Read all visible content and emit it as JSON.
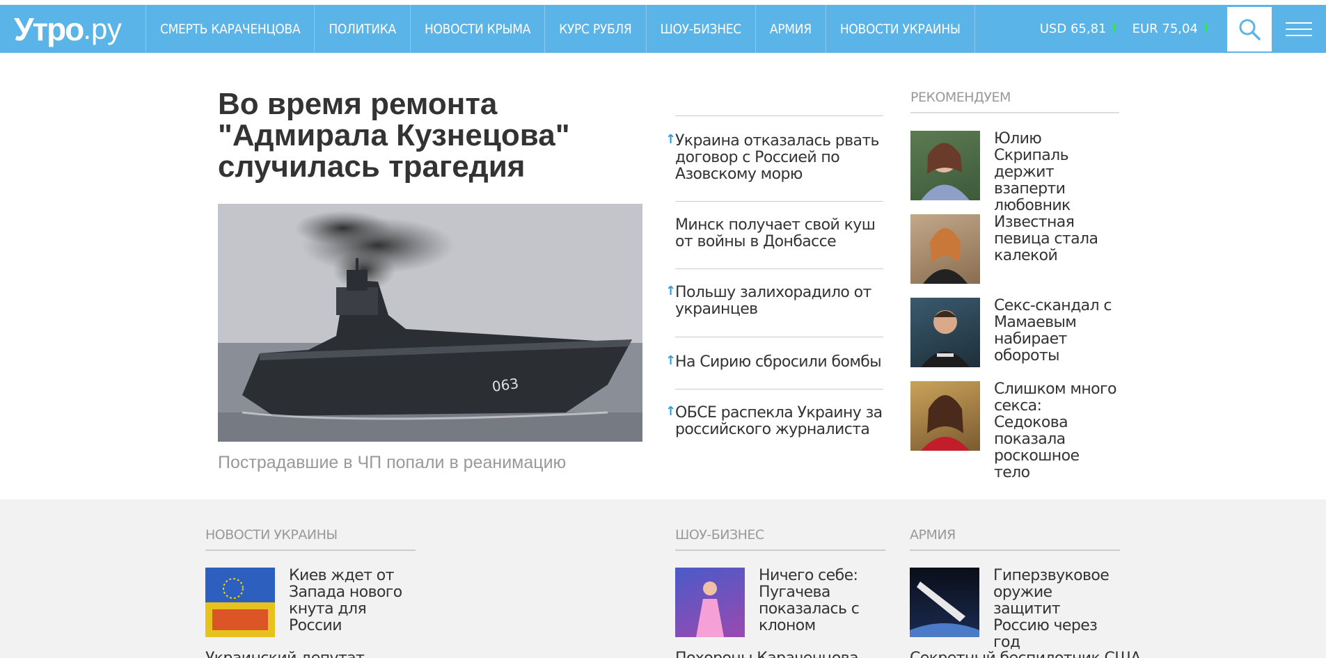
{
  "header": {
    "logo_main": "Утро",
    "logo_suffix": ".ру",
    "nav": [
      "Смерть Караченцова",
      "Политика",
      "Новости Крыма",
      "Курс рубля",
      "Шоу-бизнес",
      "Армия",
      "Новости Украины"
    ],
    "rates": [
      {
        "label": "USD",
        "value": "65,81",
        "arrow": "↑"
      },
      {
        "label": "EUR",
        "value": "75,04",
        "arrow": "↑"
      }
    ]
  },
  "main": {
    "title": "Во время ремонта \"Адмирала Кузнецова\" случилась трагедия",
    "caption": "Пострадавшие в ЧП попали в реанимацию"
  },
  "mid_list": [
    {
      "text": "Украина отказалась рвать договор с Россией по Азовскому морю",
      "up": true
    },
    {
      "text": "Минск получает свой куш от войны в Донбассе",
      "up": false
    },
    {
      "text": "Польшу залихорадило от украинцев",
      "up": true
    },
    {
      "text": "На Сирию сбросили бомбы",
      "up": true
    },
    {
      "text": "ОБСЕ распекла Украину за российского журналиста",
      "up": true
    }
  ],
  "recommended": {
    "heading": "Рекомендуем",
    "items": [
      "Юлию Скрипаль держит взаперти любовник",
      "Известная певица стала калекой",
      "Секс-скандал с Мамаевым набирает обороты",
      "Слишком много секса: Седокова показала роскошное тело"
    ]
  },
  "sections": [
    {
      "heading": "Новости Украины",
      "item": "Киев ждет от Запада нового кнута для России",
      "next": "Украинский депутат"
    },
    {
      "heading": "Шоу-бизнес",
      "item": "Ничего себе: Пугачева показалась с клоном",
      "next": "Похороны Караченцова"
    },
    {
      "heading": "Армия",
      "item": "Гиперзвуковое оружие защитит Россию через год",
      "next": "Секретный беспилотник США"
    }
  ],
  "icons": {
    "search": "search-icon",
    "menu": "hamburger-menu-icon",
    "rate_up": "arrow-up-icon"
  },
  "colors": {
    "header_bg": "#5ab4e8",
    "rate_up": "#2ee84a",
    "accent": "#2c9cde"
  }
}
